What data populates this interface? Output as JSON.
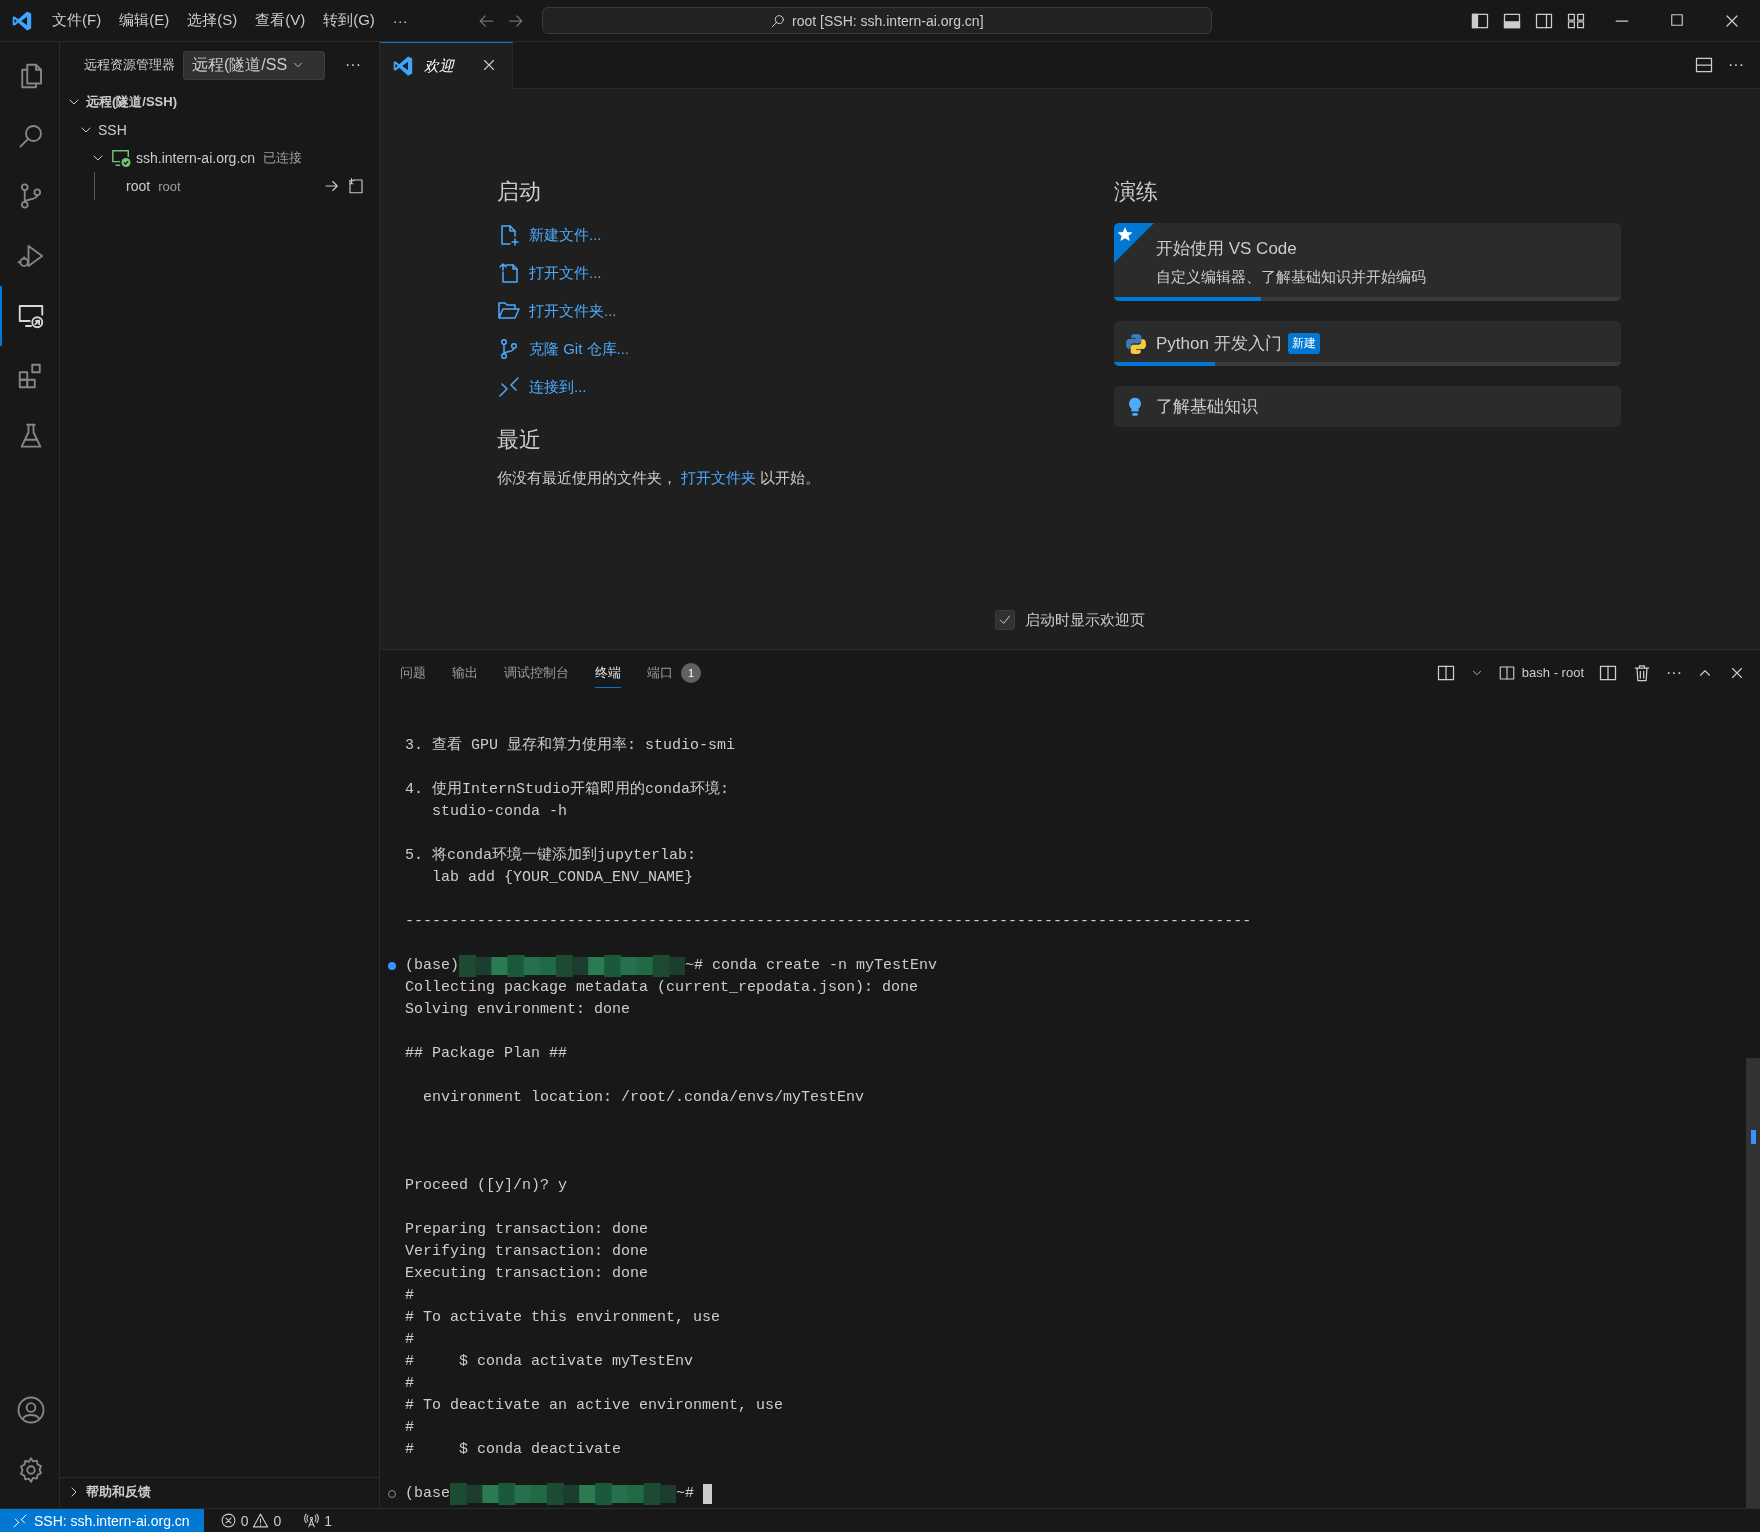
{
  "title_bar": {
    "menu": [
      {
        "label": "文件(F)"
      },
      {
        "label": "编辑(E)"
      },
      {
        "label": "选择(S)"
      },
      {
        "label": "查看(V)"
      },
      {
        "label": "转到(G)"
      }
    ],
    "more": "···",
    "command_center": "root [SSH: ssh.intern-ai.org.cn]"
  },
  "activity_bar": {
    "items": [
      {
        "kind": "explorer",
        "selected": false
      },
      {
        "kind": "search",
        "selected": false
      },
      {
        "kind": "source-control",
        "selected": false
      },
      {
        "kind": "run",
        "selected": false
      },
      {
        "kind": "remote",
        "selected": true
      },
      {
        "kind": "extensions",
        "selected": false
      },
      {
        "kind": "testing",
        "selected": false
      }
    ],
    "bottom": [
      {
        "kind": "account"
      },
      {
        "kind": "settings"
      }
    ]
  },
  "sidebar": {
    "title": "远程资源管理器",
    "dropdown": "远程(隧道/SS",
    "more": "···",
    "tree": [
      {
        "label": "远程(隧道/SSH)",
        "kind": "section",
        "expanded": true,
        "children": [
          {
            "label": "SSH",
            "expanded": true,
            "children": [
              {
                "label": "ssh.intern-ai.org.cn",
                "description": "已连接",
                "kind": "host",
                "expanded": true,
                "children": [
                  {
                    "label": "root",
                    "description": "root",
                    "kind": "folder"
                  }
                ]
              }
            ]
          }
        ]
      }
    ],
    "footer_section": {
      "label": "帮助和反馈",
      "expanded": false
    }
  },
  "editor": {
    "tabs": [
      {
        "label": "欢迎",
        "selected": true
      }
    ],
    "welcome": {
      "start": {
        "heading": "启动",
        "items": [
          {
            "kind": "new-file",
            "label": "新建文件..."
          },
          {
            "kind": "open-file",
            "label": "打开文件..."
          },
          {
            "kind": "open-folder",
            "label": "打开文件夹..."
          },
          {
            "kind": "clone",
            "label": "克隆 Git 仓库..."
          },
          {
            "kind": "connect",
            "label": "连接到..."
          }
        ]
      },
      "recent": {
        "heading": "最近",
        "text_before": "你没有最近使用的文件夹，",
        "link": "打开文件夹",
        "text_after": "以开始。"
      },
      "walkthroughs": {
        "heading": "演练",
        "items": [
          {
            "kind": "featured",
            "title": "开始使用 VS Code",
            "description": "自定义编辑器、了解基础知识并开始编码",
            "level": 0.29
          },
          {
            "kind": "python",
            "title": "Python 开发入门",
            "badge": "新建",
            "level": 0.2
          },
          {
            "kind": "bulb",
            "title": "了解基础知识"
          }
        ]
      },
      "show_on_startup": {
        "label": "启动时显示欢迎页",
        "checked": true
      }
    }
  },
  "panel": {
    "tabs": [
      {
        "label": "问题",
        "selected": false
      },
      {
        "label": "输出",
        "selected": false
      },
      {
        "label": "调试控制台",
        "selected": false
      },
      {
        "label": "终端",
        "selected": true
      },
      {
        "label": "端口",
        "selected": false,
        "badge": "1"
      }
    ],
    "terminal_name": "bash - root",
    "lines": [
      {
        "kind": "text",
        "text": "3. 查看 GPU 显存和算力使用率: studio-smi"
      },
      {
        "kind": "blank"
      },
      {
        "kind": "text",
        "text": "4. 使用InternStudio开箱即用的conda环境:"
      },
      {
        "kind": "text",
        "text": "   studio-conda -h"
      },
      {
        "kind": "blank"
      },
      {
        "kind": "text",
        "text": "5. 将conda环境一键添加到jupyterlab:"
      },
      {
        "kind": "text",
        "text": "   lab add {YOUR_CONDA_ENV_NAME}"
      },
      {
        "kind": "blank"
      },
      {
        "kind": "text",
        "text": "----------------------------------------------------------------------------------------------"
      },
      {
        "kind": "blank"
      },
      {
        "kind": "prompt",
        "prefix": "(base)",
        "command": "~# conda create -n myTestEnv",
        "completed": true
      },
      {
        "kind": "text",
        "text": "Collecting package metadata (current_repodata.json): done"
      },
      {
        "kind": "text",
        "text": "Solving environment: done"
      },
      {
        "kind": "blank"
      },
      {
        "kind": "text",
        "text": "## Package Plan ##"
      },
      {
        "kind": "blank"
      },
      {
        "kind": "text",
        "text": "  environment location: /root/.conda/envs/myTestEnv"
      },
      {
        "kind": "blank"
      },
      {
        "kind": "blank"
      },
      {
        "kind": "blank"
      },
      {
        "kind": "text",
        "text": "Proceed ([y]/n)? y"
      },
      {
        "kind": "blank"
      },
      {
        "kind": "text",
        "text": "Preparing transaction: done"
      },
      {
        "kind": "text",
        "text": "Verifying transaction: done"
      },
      {
        "kind": "text",
        "text": "Executing transaction: done"
      },
      {
        "kind": "text",
        "text": "#"
      },
      {
        "kind": "text",
        "text": "# To activate this environment, use"
      },
      {
        "kind": "text",
        "text": "#"
      },
      {
        "kind": "text",
        "text": "#     $ conda activate myTestEnv"
      },
      {
        "kind": "text",
        "text": "#"
      },
      {
        "kind": "text",
        "text": "# To deactivate an active environment, use"
      },
      {
        "kind": "text",
        "text": "#"
      },
      {
        "kind": "text",
        "text": "#     $ conda deactivate"
      },
      {
        "kind": "blank"
      },
      {
        "kind": "prompt",
        "prefix": "(base",
        "command": "~#",
        "completed": false,
        "cursor": true
      }
    ]
  },
  "status_bar": {
    "remote": "SSH: ssh.intern-ai.org.cn",
    "errors": "0",
    "warnings": "0",
    "ports": "1"
  }
}
